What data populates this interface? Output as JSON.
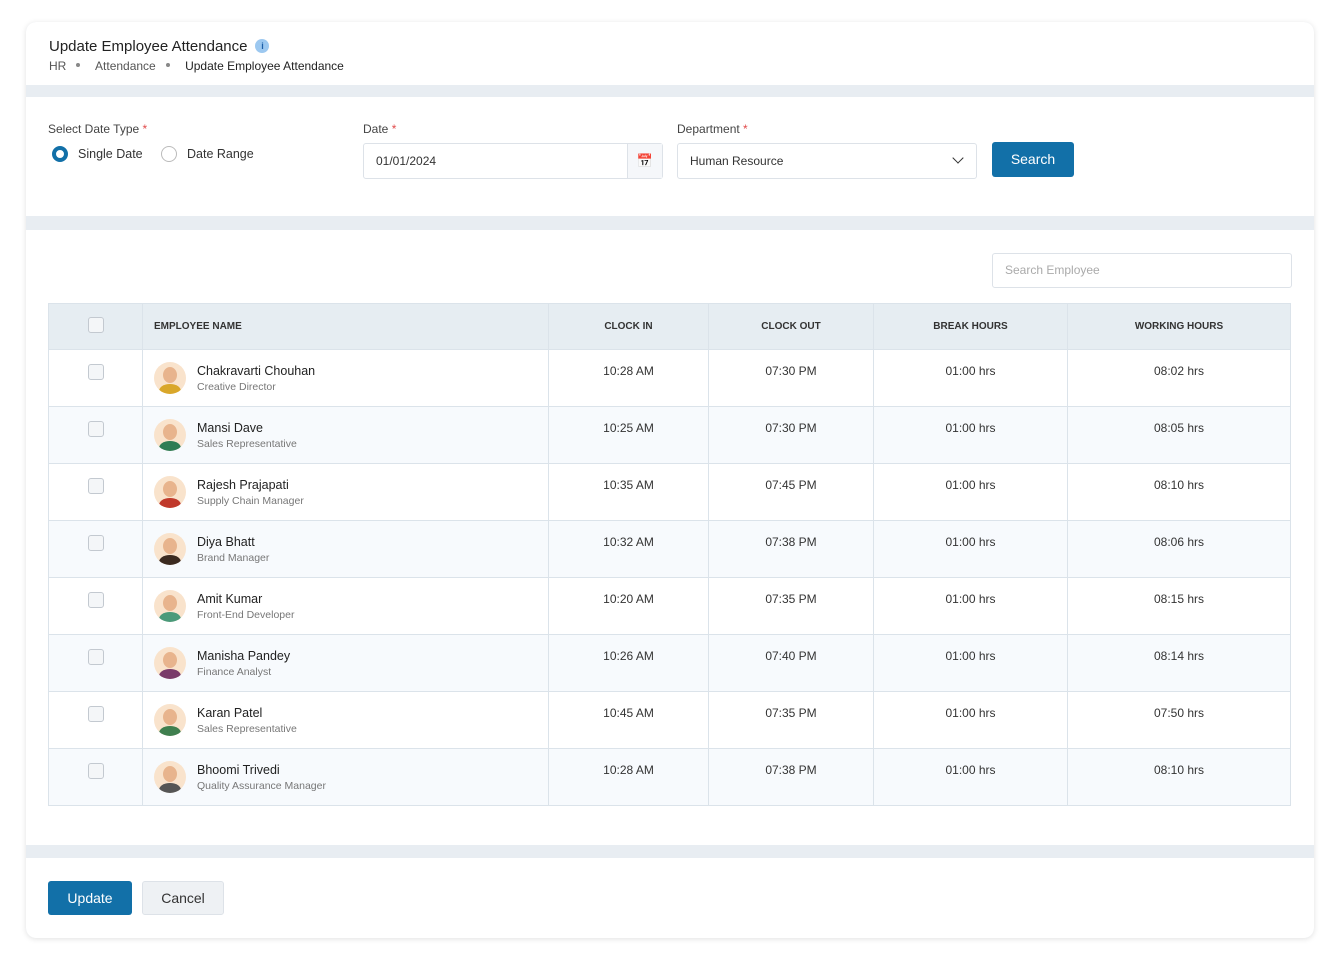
{
  "header": {
    "title": "Update Employee Attendance",
    "breadcrumb": [
      "HR",
      "Attendance",
      "Update Employee Attendance"
    ]
  },
  "filters": {
    "date_type_label": "Select Date Type",
    "options": [
      "Single Date",
      "Date Range"
    ],
    "selected": "Single Date",
    "date_label": "Date",
    "date_value": "01/01/2024",
    "department_label": "Department",
    "department_value": "Human Resource",
    "search_button": "Search",
    "required_mark": "*"
  },
  "table": {
    "search_placeholder": "Search Employee",
    "columns": [
      "EMPLOYEE NAME",
      "CLOCK IN",
      "CLOCK OUT",
      "BREAK HOURS",
      "WORKING HOURS"
    ],
    "rows": [
      {
        "name": "Chakravarti Chouhan",
        "role": "Creative Director",
        "clock_in": "10:28 AM",
        "clock_out": "07:30 PM",
        "break": "01:00 hrs",
        "working": "08:02 hrs",
        "shirt": "#d9a72a"
      },
      {
        "name": "Mansi Dave",
        "role": "Sales Representative",
        "clock_in": "10:25 AM",
        "clock_out": "07:30 PM",
        "break": "01:00 hrs",
        "working": "08:05 hrs",
        "shirt": "#2f7d55"
      },
      {
        "name": "Rajesh Prajapati",
        "role": "Supply Chain Manager",
        "clock_in": "10:35 AM",
        "clock_out": "07:45 PM",
        "break": "01:00 hrs",
        "working": "08:10 hrs",
        "shirt": "#c0392b"
      },
      {
        "name": "Diya Bhatt",
        "role": "Brand Manager",
        "clock_in": "10:32 AM",
        "clock_out": "07:38 PM",
        "break": "01:00 hrs",
        "working": "08:06 hrs",
        "shirt": "#3b2a20"
      },
      {
        "name": "Amit Kumar",
        "role": "Front-End Developer",
        "clock_in": "10:20 AM",
        "clock_out": "07:35 PM",
        "break": "01:00 hrs",
        "working": "08:15 hrs",
        "shirt": "#4a9a7a"
      },
      {
        "name": "Manisha Pandey",
        "role": "Finance Analyst",
        "clock_in": "10:26 AM",
        "clock_out": "07:40 PM",
        "break": "01:00 hrs",
        "working": "08:14 hrs",
        "shirt": "#7a3b6a"
      },
      {
        "name": "Karan Patel",
        "role": "Sales Representative",
        "clock_in": "10:45 AM",
        "clock_out": "07:35 PM",
        "break": "01:00 hrs",
        "working": "07:50 hrs",
        "shirt": "#3f7f4f"
      },
      {
        "name": "Bhoomi Trivedi",
        "role": "Quality Assurance Manager",
        "clock_in": "10:28 AM",
        "clock_out": "07:38 PM",
        "break": "01:00 hrs",
        "working": "08:10 hrs",
        "shirt": "#555555"
      }
    ]
  },
  "footer": {
    "update": "Update",
    "cancel": "Cancel"
  },
  "colors": {
    "primary": "#1270a8",
    "header_bg": "#e6edf2"
  }
}
